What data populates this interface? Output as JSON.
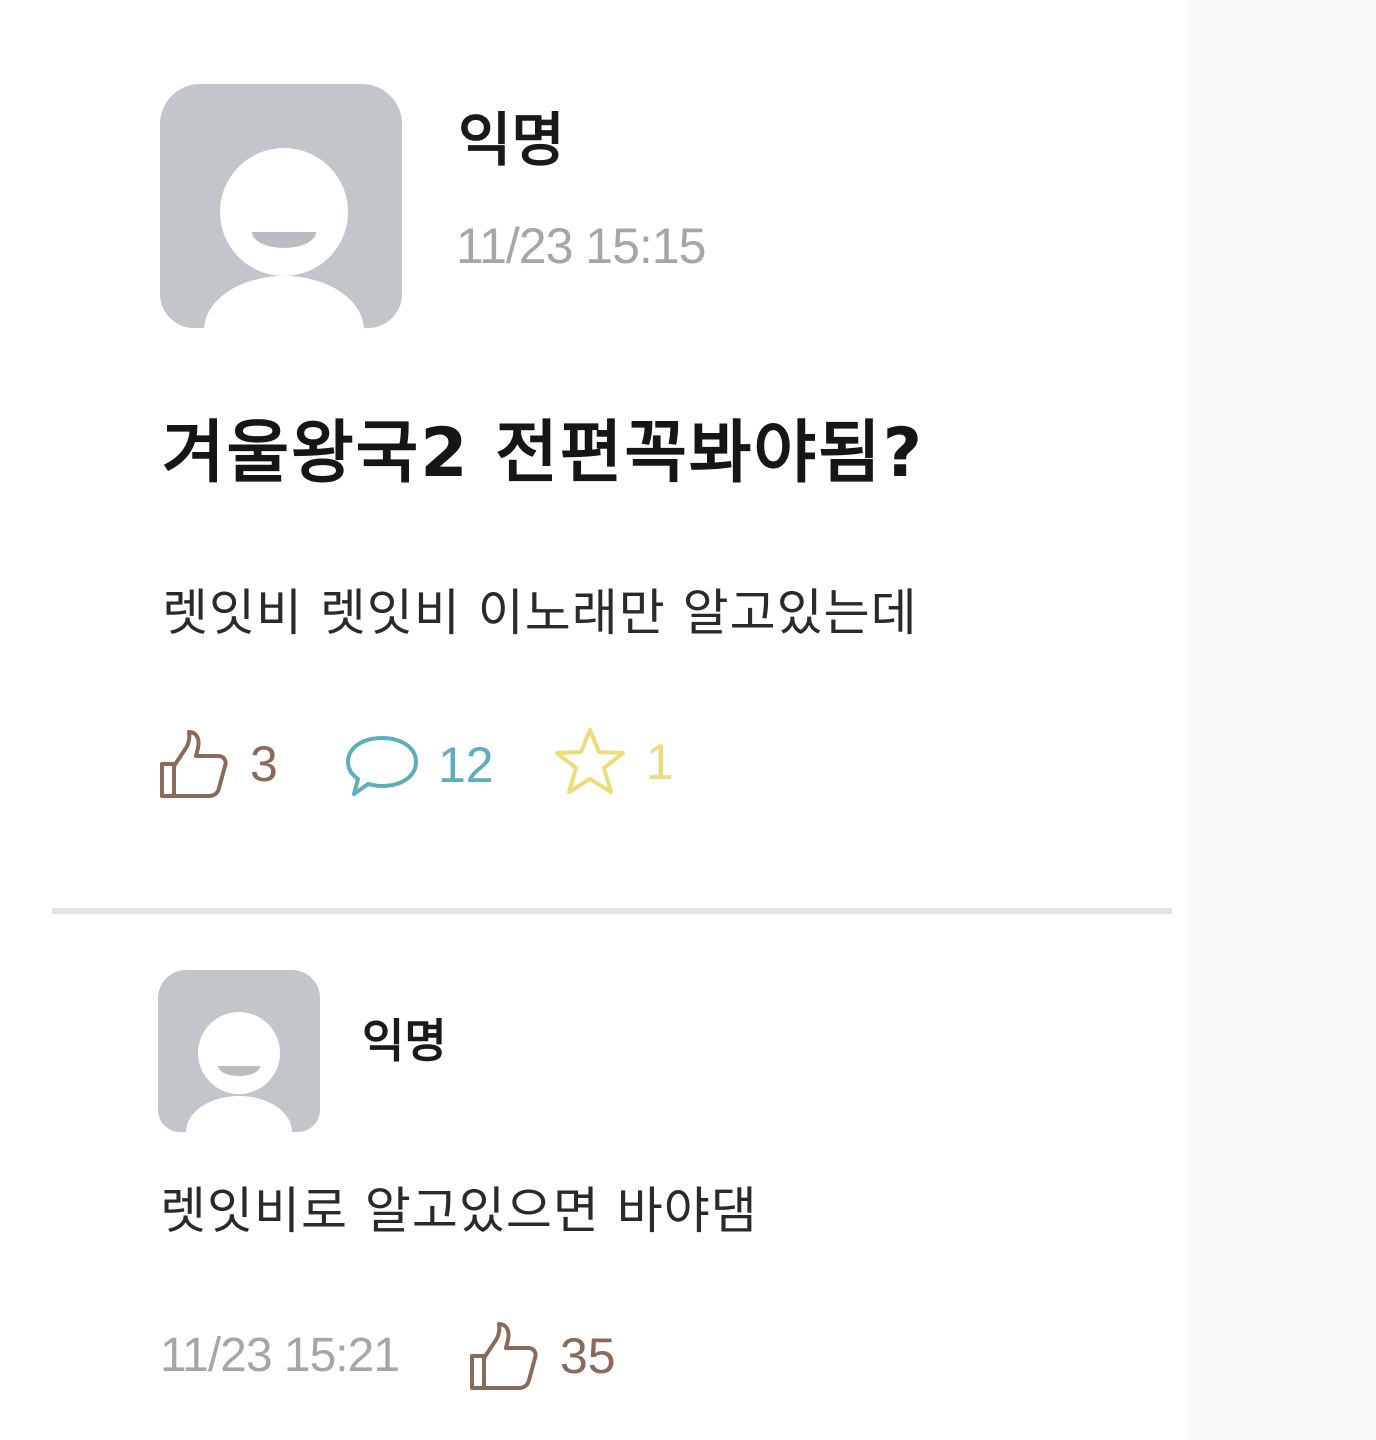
{
  "post": {
    "author": "익명",
    "time": "11/23 15:15",
    "title": "겨울왕국2 전편꼭봐야됨?",
    "body": "렛잇비 렛잇비 이노래만 알고있는데",
    "stats": {
      "likes": "3",
      "comments": "12",
      "scraps": "1"
    },
    "icons": {
      "like": "thumbs-up-icon",
      "comment": "speech-bubble-icon",
      "scrap": "star-icon"
    },
    "colors": {
      "like": "#8a6a5a",
      "comment": "#5aaebd",
      "scrap": "#eadd7a"
    }
  },
  "comment": {
    "author": "익명",
    "body": "렛잇비로 알고있으면 바야댐",
    "time": "11/23 15:21",
    "likes": "35"
  }
}
